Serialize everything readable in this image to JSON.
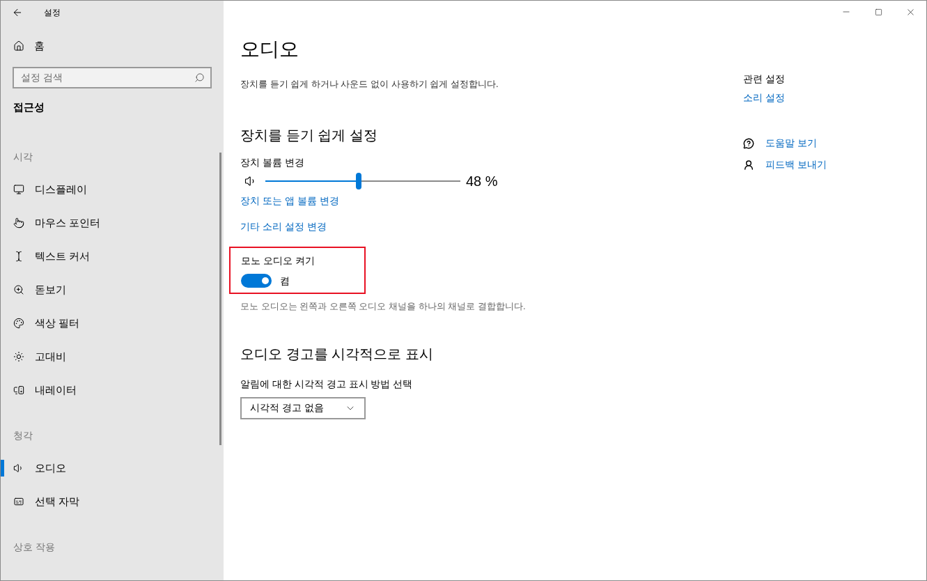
{
  "window": {
    "title": "설정"
  },
  "sidebar": {
    "home": "홈",
    "search": {
      "placeholder": "설정 검색"
    },
    "category": "접근성",
    "groups": [
      {
        "heading": "시각",
        "items": [
          {
            "label": "디스플레이",
            "selected": false
          },
          {
            "label": "마우스 포인터",
            "selected": false
          },
          {
            "label": "텍스트 커서",
            "selected": false
          },
          {
            "label": "돋보기",
            "selected": false
          },
          {
            "label": "색상 필터",
            "selected": false
          },
          {
            "label": "고대비",
            "selected": false
          },
          {
            "label": "내레이터",
            "selected": false
          }
        ]
      },
      {
        "heading": "청각",
        "items": [
          {
            "label": "오디오",
            "selected": true
          },
          {
            "label": "선택 자막",
            "selected": false
          }
        ]
      },
      {
        "heading": "상호 작용"
      }
    ]
  },
  "page": {
    "title": "오디오",
    "description": "장치를 듣기 쉽게 하거나 사운드 없이 사용하기 쉽게 설정합니다.",
    "section1": {
      "heading": "장치를 듣기 쉽게 설정",
      "volume": {
        "label": "장치 볼륨 변경",
        "level": 0.48,
        "reading": "48 %"
      },
      "links": [
        "장치 또는 앱 볼륨 변경",
        "기타 소리 설정 변경"
      ],
      "mono": {
        "label": "모노 오디오 켜기",
        "on": true,
        "state_text": "켬",
        "highlighted": true
      },
      "mono_description": "모노 오디오는 왼쪽과 오른쪽 오디오 채널을 하나의 채널로 결합합니다."
    },
    "section2": {
      "heading": "오디오 경고를 시각적으로 표시",
      "label": "알림에 대한 시각적 경고 표시 방법 선택",
      "dropdown": {
        "value": "시각적 경고 없음"
      }
    }
  },
  "related": {
    "heading": "관련 설정",
    "link": "소리 설정",
    "help": [
      {
        "label": "도움말 보기"
      },
      {
        "label": "피드백 보내기"
      }
    ]
  }
}
